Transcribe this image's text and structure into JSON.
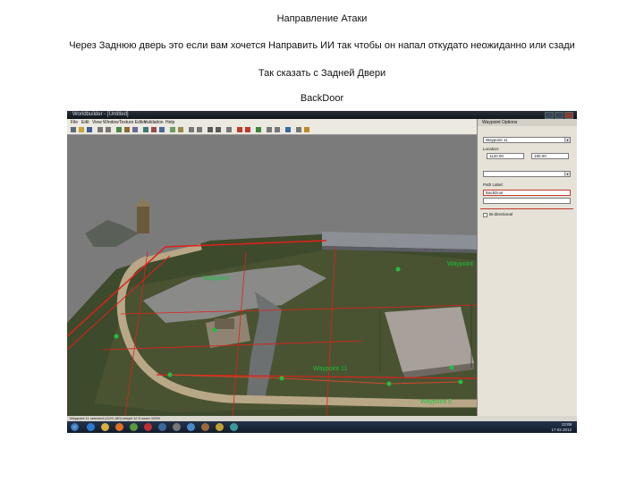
{
  "caption": {
    "title": "Направление Атаки",
    "description": "Через Заднюю дверь это если вам хочется Направить ИИ так чтобы он напал откудато неожиданно или сзади",
    "subtitle": "Так сказать с Задней Двери",
    "keyword": "BackDoor"
  },
  "editor": {
    "window_title": "Worldbuilder - [Untitled]",
    "menu": [
      "File",
      "Edit",
      "View",
      "Window",
      "Texture Editor",
      "Validation",
      "Help"
    ],
    "waypoint_labels": [
      "Waypoint",
      "Waypoint",
      "Waypoint 11",
      "Waypoint 5"
    ],
    "panel": {
      "title": "Waypoint Options",
      "name_value": "Waypoint 11",
      "location_label": "Location:",
      "x_value": "1120.00",
      "y_value": "180.00",
      "path_label": "Path Label:",
      "path_value": "BackDoor",
      "checkbox_label": "Bi-directional"
    },
    "status_text": "Waypoint 11 selected  (1120,180)  height 12.5  zoom 100%",
    "clock_time": "13:08",
    "clock_date": "17.02.2012"
  }
}
